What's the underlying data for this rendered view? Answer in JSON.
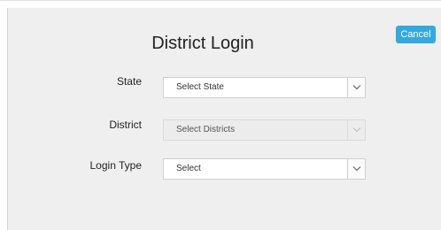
{
  "dialog": {
    "title": "District Login",
    "cancel_label": "Cancel",
    "accent_color": "#33a9df"
  },
  "fields": [
    {
      "label": "State",
      "value": "Select State",
      "disabled": false
    },
    {
      "label": "District",
      "value": "Select Districts",
      "disabled": true
    },
    {
      "label": "Login Type",
      "value": "Select",
      "disabled": false
    }
  ],
  "icons": {
    "dropdown": "chevron-down-icon"
  }
}
